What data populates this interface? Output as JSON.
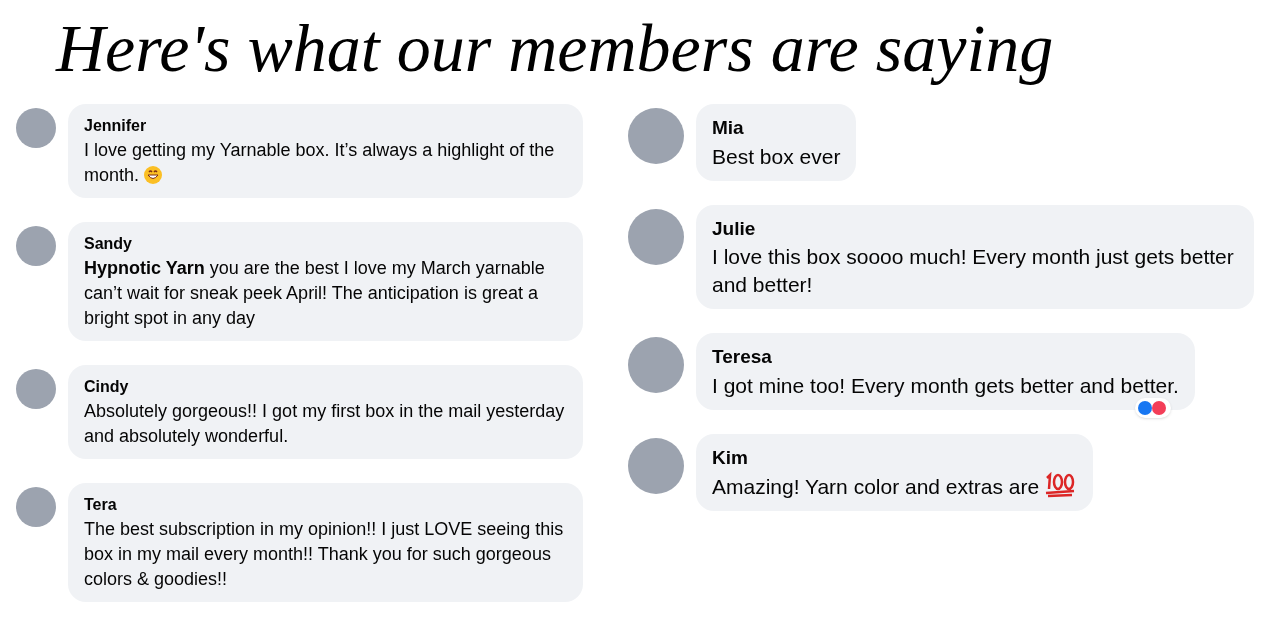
{
  "title": "Here's what our members are saying",
  "columns": [
    [
      {
        "name": "Jennifer",
        "text": "I love getting my Yarnable box. It’s always a highlight of the month.",
        "kind": "grin"
      },
      {
        "name": "Sandy",
        "text": "**Hypnotic Yarn** you are the best I love my March yarnable can’t wait for sneak peek April! The anticipation is great a bright spot in any day",
        "kind": "plain"
      },
      {
        "name": "Cindy",
        "text": "Absolutely gorgeous!! I got my first box in the mail yesterday and absolutely wonderful.",
        "kind": "plain"
      },
      {
        "name": "Tera",
        "text": "The best subscription in my opinion!! I just LOVE seeing this box in my mail every month!! Thank you for such gorgeous colors & goodies!!",
        "kind": "plain"
      }
    ],
    [
      {
        "name": "Mia",
        "text": "Best box ever",
        "kind": "plain"
      },
      {
        "name": "Julie",
        "text": "I love this box soooo much! Every month just gets better and better!",
        "kind": "plain"
      },
      {
        "name": "Teresa",
        "text": "I got mine too! Every month gets better and better.",
        "kind": "plain",
        "reactions": true
      },
      {
        "name": "Kim",
        "text": "Amazing! Yarn color and extras are",
        "kind": "hundred"
      }
    ]
  ]
}
